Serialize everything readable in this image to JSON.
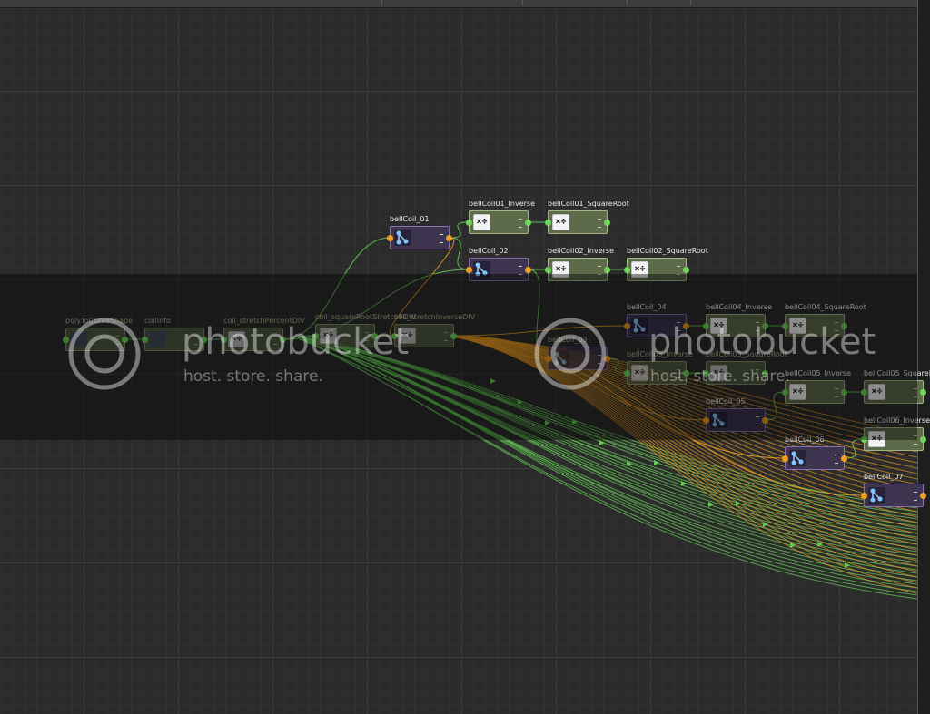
{
  "nodes": [
    {
      "id": "polyToCurveShape",
      "label": "polyToCurveShape",
      "kind": "util",
      "icon": "shape-icon",
      "dim": true
    },
    {
      "id": "coilInfo",
      "label": "coilInfo",
      "kind": "util",
      "icon": "curve-info-icon",
      "dim": true
    },
    {
      "id": "coil_stretchPercentDIV",
      "label": "coil_stretchPercentDIV",
      "kind": "util",
      "icon": "multiply-divide-icon",
      "dim": true
    },
    {
      "id": "coil_squareRootStretchPOW",
      "label": "coil_squareRootStretchPOW",
      "kind": "util",
      "icon": "multiply-divide-icon",
      "dim": true
    },
    {
      "id": "coil_stretchInverseDIV",
      "label": "coil_stretchInverseDIV",
      "kind": "util",
      "icon": "multiply-divide-icon",
      "dim": true
    },
    {
      "id": "bellCoil_01",
      "label": "bellCoil_01",
      "kind": "remap",
      "icon": "remap-value-icon",
      "dim": false
    },
    {
      "id": "bellCoil01_Inverse",
      "label": "bellCoil01_Inverse",
      "kind": "util",
      "icon": "multiply-divide-icon",
      "dim": false
    },
    {
      "id": "bellCoil01_SquareRoot",
      "label": "bellCoil01_SquareRoot",
      "kind": "util",
      "icon": "multiply-divide-icon",
      "dim": false
    },
    {
      "id": "bellCoil_02",
      "label": "bellCoil_02",
      "kind": "remap",
      "icon": "remap-value-icon",
      "dim": false
    },
    {
      "id": "bellCoil02_Inverse",
      "label": "bellCoil02_Inverse",
      "kind": "util",
      "icon": "multiply-divide-icon",
      "dim": false
    },
    {
      "id": "bellCoil02_SquareRoot",
      "label": "bellCoil02_SquareRoot",
      "kind": "util",
      "icon": "multiply-divide-icon",
      "dim": false
    },
    {
      "id": "bellCoil_03",
      "label": "bellCoil_03",
      "kind": "remap",
      "icon": "remap-value-icon",
      "dim": true
    },
    {
      "id": "bellCoil_04",
      "label": "bellCoil_04",
      "kind": "remap",
      "icon": "remap-value-icon",
      "dim": false
    },
    {
      "id": "bellCoil04_Inverse",
      "label": "bellCoil04_Inverse",
      "kind": "util",
      "icon": "multiply-divide-icon",
      "dim": false
    },
    {
      "id": "bellCoil04_SquareRoot",
      "label": "bellCoil04_SquareRoot",
      "kind": "util",
      "icon": "multiply-divide-icon",
      "dim": false
    },
    {
      "id": "bellCoil03_Inverse",
      "label": "bellCoil03_Inverse",
      "kind": "util",
      "icon": "multiply-divide-icon",
      "dim": true
    },
    {
      "id": "bellCoil03_SquareRoot",
      "label": "bellCoil03_SquareRoot",
      "kind": "util",
      "icon": "multiply-divide-icon",
      "dim": true
    },
    {
      "id": "bellCoil05_Inverse",
      "label": "bellCoil05_Inverse",
      "kind": "util",
      "icon": "multiply-divide-icon",
      "dim": false
    },
    {
      "id": "bellCoil05_SquareRoot",
      "label": "bellCoil05_SquareRoot",
      "kind": "util",
      "icon": "multiply-divide-icon",
      "dim": false
    },
    {
      "id": "bellCoil_05",
      "label": "bellCoil_05",
      "kind": "remap",
      "icon": "remap-value-icon",
      "dim": false
    },
    {
      "id": "bellCoil06_Inverse",
      "label": "bellCoil06_Inverse",
      "kind": "util",
      "icon": "multiply-divide-icon",
      "dim": false
    },
    {
      "id": "bellCoil_06",
      "label": "bellCoil_06",
      "kind": "remap",
      "icon": "remap-value-icon",
      "dim": false
    },
    {
      "id": "bellCoil_07",
      "label": "bellCoil_07",
      "kind": "remap",
      "icon": "remap-value-icon",
      "dim": false
    }
  ],
  "calc_icon_glyph": "×÷",
  "colors": {
    "background": "#2b2b2b",
    "utility_node": "#5e6b4a",
    "remap_node": "#3d3550",
    "wire_green": "#66cc55",
    "wire_orange": "#e89a22"
  },
  "watermark": {
    "brand": "photobucket",
    "tagline": "host. store. share."
  }
}
